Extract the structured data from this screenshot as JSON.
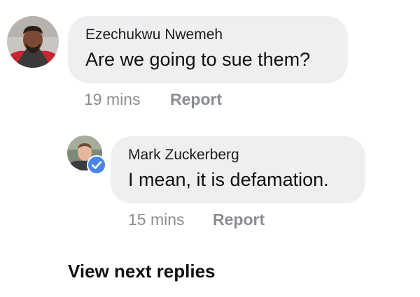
{
  "comments": [
    {
      "author": "Ezechukwu Nwemeh",
      "text": "Are we going to sue them?",
      "time": "19 mins",
      "report_label": "Report",
      "avatar_icon": "user-photo-avatar"
    },
    {
      "author": "Mark Zuckerberg",
      "text": "I mean, it is defamation.",
      "time": "15 mins",
      "report_label": "Report",
      "avatar_icon": "user-photo-avatar",
      "badge_icon": "verified-check-icon"
    }
  ],
  "view_next_label": "View next replies",
  "colors": {
    "bubble_bg": "#efeff2",
    "meta_text": "#8a8d91",
    "verified_blue": "#4a86e8"
  }
}
